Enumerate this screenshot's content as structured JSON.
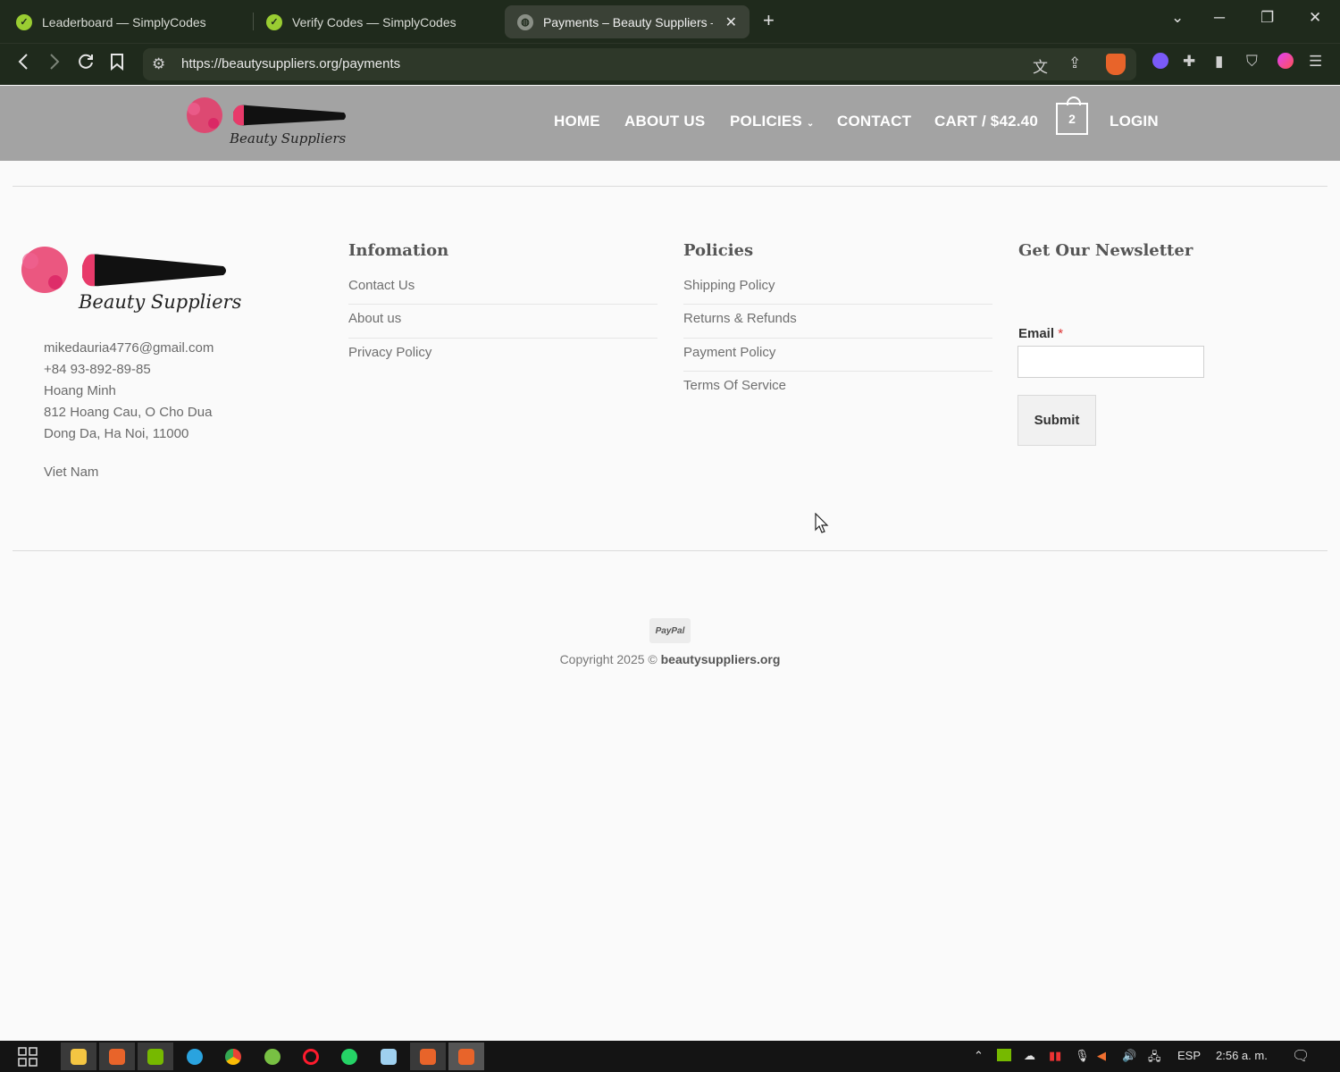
{
  "browser": {
    "tabs": [
      {
        "title": "Leaderboard — SimplyCodes"
      },
      {
        "title": "Verify Codes — SimplyCodes"
      },
      {
        "title": "Payments – Beauty Suppliers – "
      }
    ],
    "url": "https://beautysuppliers.org/payments",
    "colors": {
      "chrome": "#1f2a1c",
      "accent": "#9acd32"
    }
  },
  "header": {
    "logo_text": "Beauty Suppliers",
    "menu": {
      "home": "HOME",
      "about": "ABOUT US",
      "policies": "POLICIES",
      "contact": "CONTACT",
      "cart": "CART / $42.40",
      "cart_count": "2",
      "login": "LOGIN"
    }
  },
  "footer": {
    "contact": {
      "email": "mikedauria4776@gmail.com",
      "phone": "+84 93-892-89-85",
      "name": "Hoang Minh",
      "address1": "812 Hoang Cau, O Cho Dua",
      "address2": "Dong Da, Ha Noi, 11000",
      "country": "Viet Nam"
    },
    "information": {
      "title": "Infomation",
      "links": [
        "Contact Us",
        "About us",
        "Privacy Policy"
      ]
    },
    "policies": {
      "title": "Policies",
      "links": [
        "Shipping Policy",
        "Returns & Refunds",
        "Payment Policy",
        "Terms Of Service"
      ]
    },
    "newsletter": {
      "title": "Get Our Newsletter",
      "email_label": "Email",
      "required_mark": "*",
      "submit": "Submit"
    },
    "payment_badge": "PayPal",
    "copyright_prefix": "Copyright 2025 ©",
    "copyright_site": "beautysuppliers.org"
  },
  "taskbar": {
    "lang": "ESP",
    "time": "2:56 a. m."
  }
}
